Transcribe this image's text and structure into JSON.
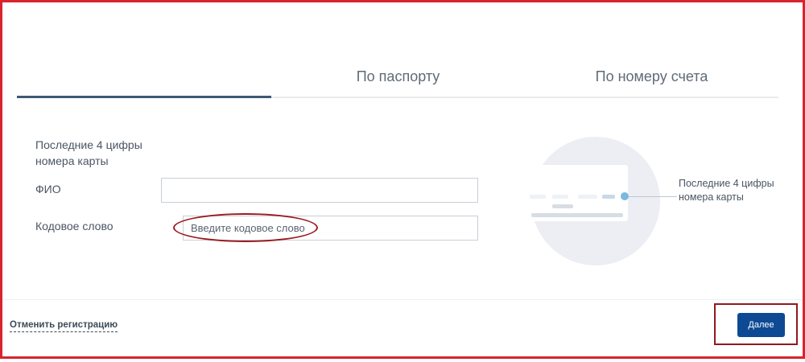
{
  "tabs": [
    {
      "label": ""
    },
    {
      "label": "По паспорту"
    },
    {
      "label": "По номеру счета"
    }
  ],
  "form": {
    "card_digits_label": "Последние 4 цифры номера карты",
    "fio_label": "ФИО",
    "fio_value": "",
    "code_word_label": "Кодовое слово",
    "code_word_placeholder": "Введите кодовое слово"
  },
  "illustration": {
    "caption": "Последние 4 цифры номера карты",
    "icon": "card-illustration"
  },
  "footer": {
    "cancel_label": "Отменить регистрацию",
    "next_label": "Далее"
  },
  "colors": {
    "accent": "#0d4a93",
    "tab_active": "#3d5a74",
    "frame_annotation": "#d9232d"
  }
}
